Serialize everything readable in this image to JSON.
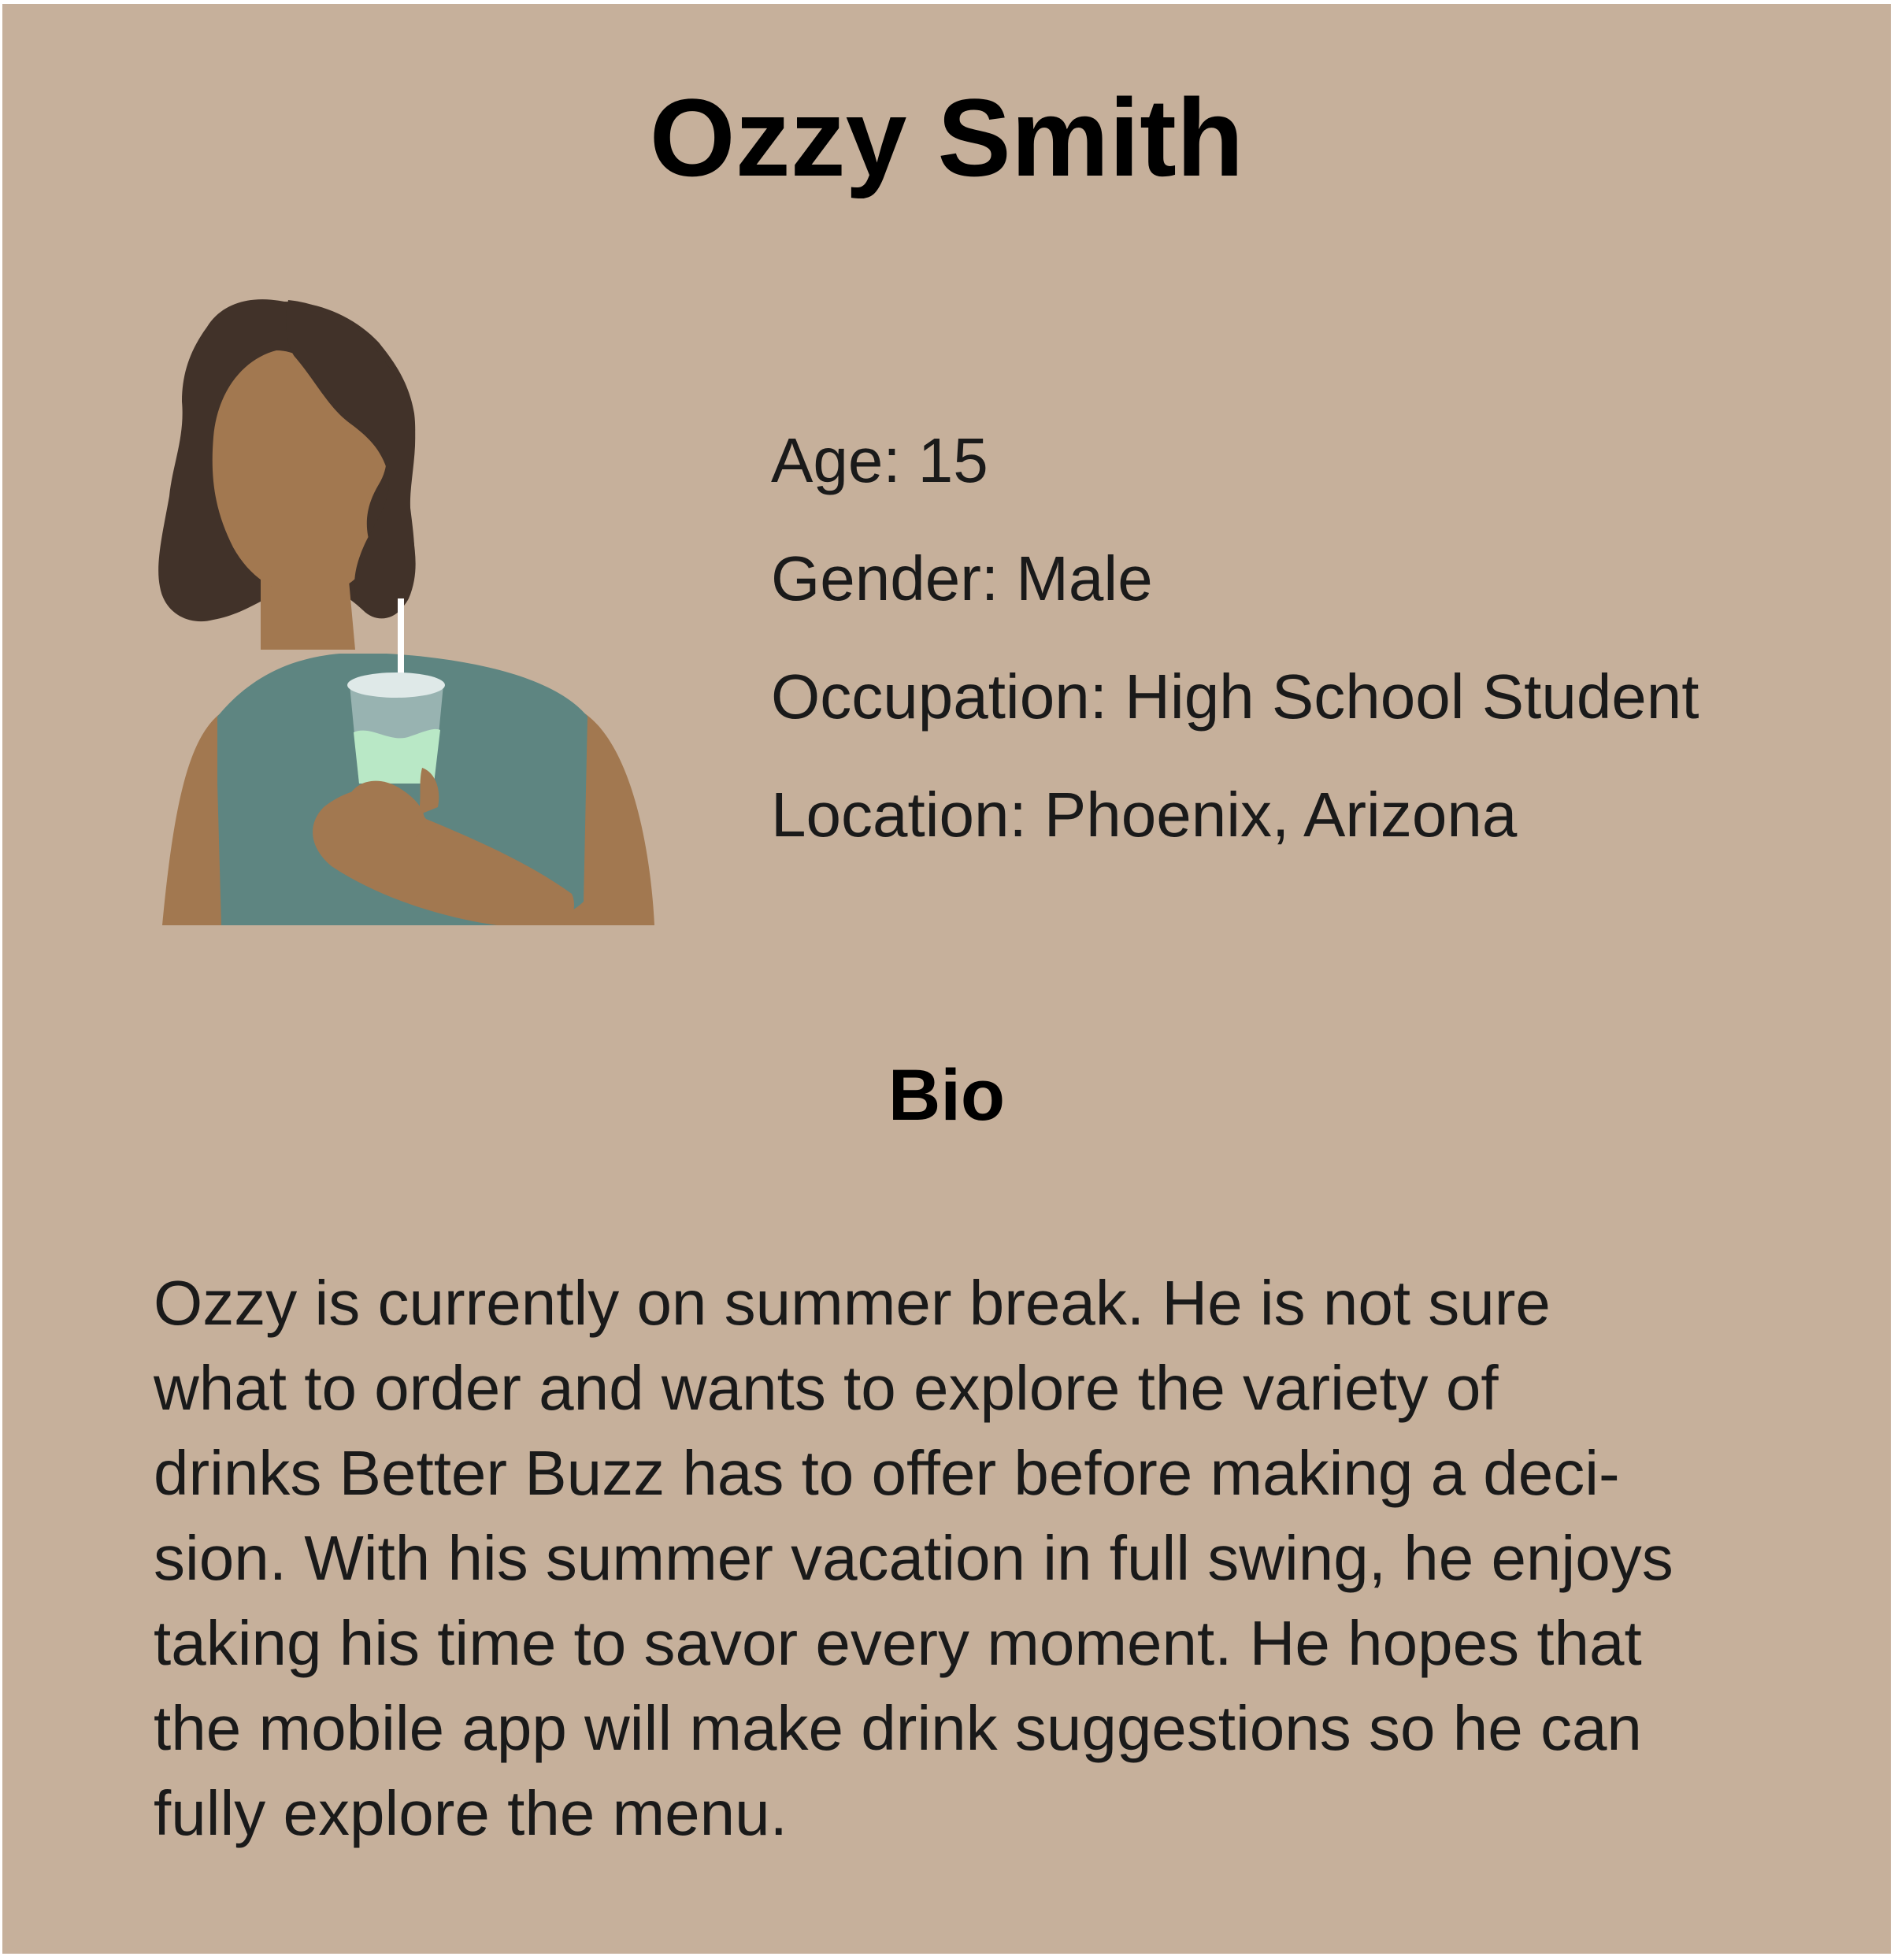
{
  "persona": {
    "name": "Ozzy Smith",
    "details": [
      "Age: 15",
      "Gender: Male",
      "Occupation: High School Student",
      "Location: Phoenix, Arizona"
    ],
    "bio_heading": "Bio",
    "bio_text": "Ozzy is currently on summer break. He is not sure\nwhat to order and wants to explore the variety of\ndrinks Better Buzz has to offer before making a deci-\nsion. With his summer vacation in full swing, he enjoys\ntaking his time to savor every moment. He hopes that\nthe mobile app will make drink suggestions so he can\nfully explore the menu."
  },
  "avatar_icon": "person-drinking-icon",
  "colors": {
    "background": "#c6b09b",
    "hair": "#413229",
    "skin": "#a27850",
    "shirt": "#5e8581",
    "cup": "#98b3b1",
    "drink": "#b9e8c6",
    "straw": "#ffffff"
  }
}
